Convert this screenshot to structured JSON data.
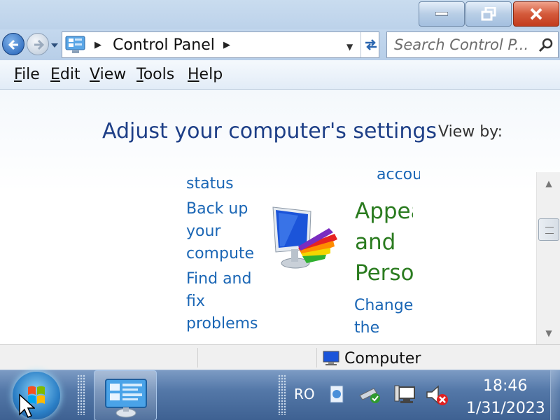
{
  "window": {
    "controls": {
      "minimize": "minimize",
      "maximize": "restore",
      "close": "close"
    }
  },
  "nav": {
    "breadcrumb": "Control Panel",
    "search_placeholder": "Search Control P..."
  },
  "menu": [
    "File",
    "Edit",
    "View",
    "Tools",
    "Help"
  ],
  "menu_underline": [
    "F",
    "E",
    "V",
    "T",
    "H"
  ],
  "content": {
    "title": "Adjust your computer's settings",
    "view_by": "View by:",
    "left_links": [
      "status",
      "Back up",
      "your",
      "compute",
      "Find and",
      "fix",
      "problems"
    ],
    "right_link_top": "accou",
    "appearance_heading": [
      "Appea",
      "and",
      "Perso"
    ],
    "appearance_links": [
      "Change",
      "the"
    ]
  },
  "statusbar": {
    "text": "Computer"
  },
  "taskbar": {
    "language": "RO",
    "time": "18:46",
    "date": "1/31/2023"
  }
}
